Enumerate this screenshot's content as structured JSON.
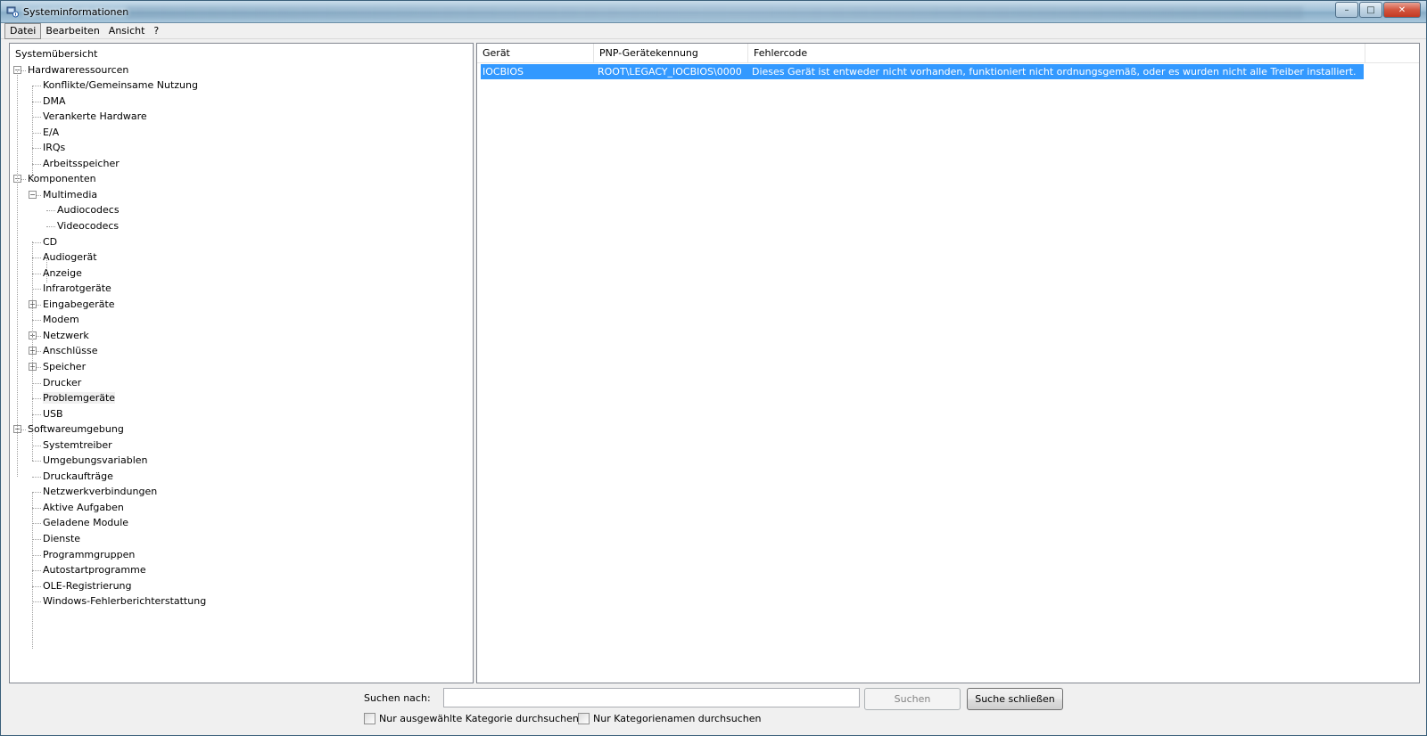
{
  "window": {
    "title": "Systeminformationen",
    "controls": {
      "minimize": "–",
      "maximize": "□",
      "close": "✕"
    }
  },
  "menu": [
    "Datei",
    "Bearbeiten",
    "Ansicht",
    "?"
  ],
  "tree": {
    "root": "Systemübersicht",
    "items": [
      {
        "label": "Hardwareressourcen",
        "level": 1,
        "expander": "minus"
      },
      {
        "label": "Konflikte/Gemeinsame Nutzung",
        "level": 2
      },
      {
        "label": "DMA",
        "level": 2
      },
      {
        "label": "Verankerte Hardware",
        "level": 2
      },
      {
        "label": "E/A",
        "level": 2
      },
      {
        "label": "IRQs",
        "level": 2
      },
      {
        "label": "Arbeitsspeicher",
        "level": 2
      },
      {
        "label": "Komponenten",
        "level": 1,
        "expander": "minus"
      },
      {
        "label": "Multimedia",
        "level": 2,
        "expander": "minus"
      },
      {
        "label": "Audiocodecs",
        "level": 3
      },
      {
        "label": "Videocodecs",
        "level": 3
      },
      {
        "label": "CD",
        "level": 2
      },
      {
        "label": "Audiogerät",
        "level": 2
      },
      {
        "label": "Anzeige",
        "level": 2
      },
      {
        "label": "Infrarotgeräte",
        "level": 2
      },
      {
        "label": "Eingabegeräte",
        "level": 2,
        "expander": "plus"
      },
      {
        "label": "Modem",
        "level": 2
      },
      {
        "label": "Netzwerk",
        "level": 2,
        "expander": "plus"
      },
      {
        "label": "Anschlüsse",
        "level": 2,
        "expander": "plus"
      },
      {
        "label": "Speicher",
        "level": 2,
        "expander": "plus"
      },
      {
        "label": "Drucker",
        "level": 2
      },
      {
        "label": "Problemgeräte",
        "level": 2,
        "selected": true
      },
      {
        "label": "USB",
        "level": 2
      },
      {
        "label": "Softwareumgebung",
        "level": 1,
        "expander": "minus"
      },
      {
        "label": "Systemtreiber",
        "level": 2
      },
      {
        "label": "Umgebungsvariablen",
        "level": 2
      },
      {
        "label": "Druckaufträge",
        "level": 2
      },
      {
        "label": "Netzwerkverbindungen",
        "level": 2
      },
      {
        "label": "Aktive Aufgaben",
        "level": 2
      },
      {
        "label": "Geladene Module",
        "level": 2
      },
      {
        "label": "Dienste",
        "level": 2
      },
      {
        "label": "Programmgruppen",
        "level": 2
      },
      {
        "label": "Autostartprogramme",
        "level": 2
      },
      {
        "label": "OLE-Registrierung",
        "level": 2
      },
      {
        "label": "Windows-Fehlerberichterstattung",
        "level": 2
      }
    ]
  },
  "table": {
    "columns": [
      "Gerät",
      "PNP-Gerätekennung",
      "Fehlercode"
    ],
    "rows": [
      [
        "IOCBIOS",
        "ROOT\\LEGACY_IOCBIOS\\0000",
        "Dieses Gerät ist entweder nicht vorhanden, funktioniert nicht ordnungsgemäß, oder es wurden nicht alle Treiber installiert."
      ]
    ],
    "selection_color": "#3399ff"
  },
  "search": {
    "label": "Suchen nach:",
    "value": "",
    "search_button": "Suchen",
    "close_button": "Suche schließen",
    "option_selected_category": "Nur ausgewählte Kategorie durchsuchen",
    "option_category_names": "Nur Kategorienamen durchsuchen"
  }
}
